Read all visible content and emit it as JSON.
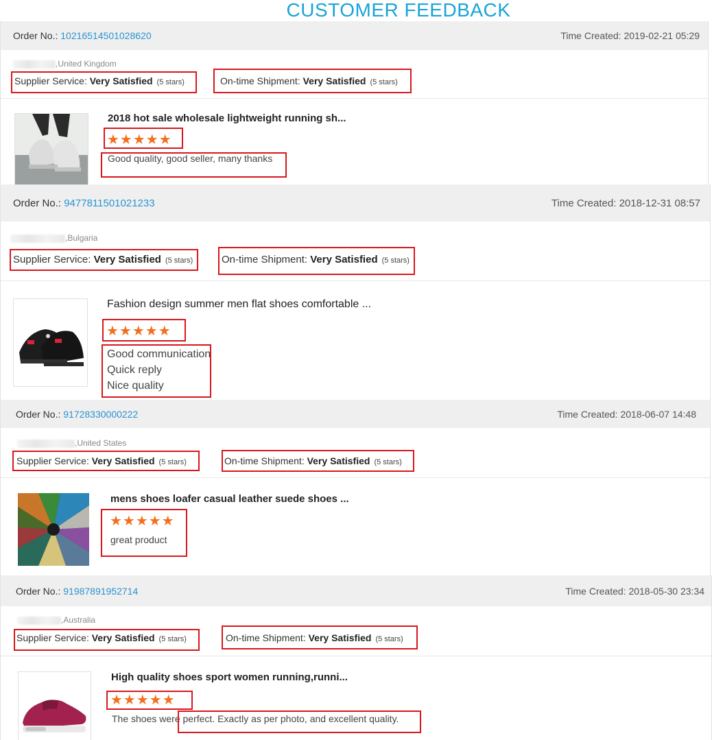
{
  "page_title": "CUSTOMER FEEDBACK",
  "labels": {
    "order_no": "Order No.:",
    "time_created": "Time Created:",
    "supplier_service": "Supplier Service:",
    "ontime_shipment": "On-time Shipment:"
  },
  "feedbacks": [
    {
      "order_no": "10216514501028620",
      "time_created": "2019-02-21 05:29",
      "country": "United Kingdom",
      "supplier_rating": "Very Satisfied",
      "supplier_stars": "(5 stars)",
      "shipment_rating": "Very Satisfied",
      "shipment_stars": "(5 stars)",
      "product_title": "2018 hot sale wholesale lightweight running sh...",
      "stars": "★★★★★",
      "comment_lines": [
        "Good quality, good seller, many thanks"
      ]
    },
    {
      "order_no": "9477811501021233",
      "time_created": "2018-12-31 08:57",
      "country": "Bulgaria",
      "supplier_rating": "Very Satisfied",
      "supplier_stars": "(5 stars)",
      "shipment_rating": "Very Satisfied",
      "shipment_stars": "(5 stars)",
      "product_title": "Fashion design summer men flat shoes comfortable ...",
      "stars": "★★★★★",
      "comment_lines": [
        "Good communication",
        "Quick reply",
        "Nice quality"
      ]
    },
    {
      "order_no": "91728330000222",
      "time_created": "2018-06-07 14:48",
      "country": "United States",
      "supplier_rating": "Very Satisfied",
      "supplier_stars": "(5 stars)",
      "shipment_rating": "Very Satisfied",
      "shipment_stars": "(5 stars)",
      "product_title": "mens shoes loafer casual leather suede shoes ...",
      "stars": "★★★★★",
      "comment_lines": [
        "great product"
      ]
    },
    {
      "order_no": "91987891952714",
      "time_created": "2018-05-30 23:34",
      "country": "Australia",
      "supplier_rating": "Very Satisfied",
      "supplier_stars": "(5 stars)",
      "shipment_rating": "Very Satisfied",
      "shipment_stars": "(5 stars)",
      "product_title": "High quality shoes sport women running,runni...",
      "stars": "★★★★★",
      "comment_lines": [
        "The shoes were perfect. Exactly as per photo, and excellent quality."
      ]
    }
  ],
  "colors": {
    "title": "#1aa3d9",
    "order_link": "#2a93d0",
    "star": "#f36f1c",
    "highlight_box": "#d8161b",
    "header_bar": "#efefef"
  }
}
